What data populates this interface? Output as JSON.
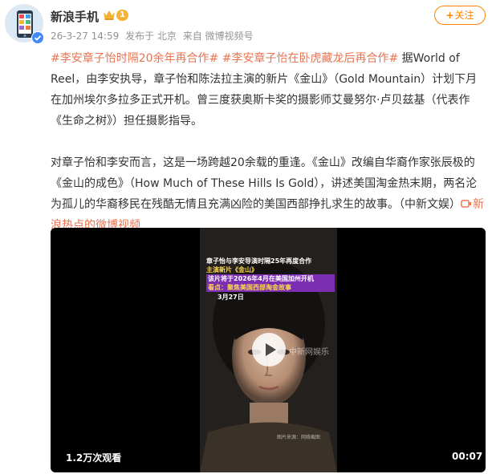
{
  "post": {
    "author": {
      "name": "新浪手机",
      "level": "1",
      "avatar_icon": "phone-app-icon",
      "verified_icon": "verified-badge-icon"
    },
    "meta": {
      "time": "26-3-27 14:59",
      "location": "发布于 北京",
      "source": "来自 微博视频号"
    },
    "follow_label": "关注",
    "paragraph_1": {
      "topic_1": "#李安章子怡时隔20余年再合作#",
      "topic_2": "#李安章子怡在卧虎藏龙后再合作#",
      "text": "据World of Reel，由李安执导，章子怡和陈法拉主演的新片《金山》（Gold Mountain）计划下月在加州埃尔多拉多正式开机。曾三度获奥斯卡奖的摄影师艾曼努尔·卢贝兹基（代表作《生命之树》）担任摄影指导。"
    },
    "paragraph_2": {
      "text": "对章子怡和李安而言，这是一场跨越20余载的重逢。《金山》改编自华裔作家张辰极的《金山的成色》（How Much of These Hills Is Gold），讲述美国淘金热末期，两名沦为孤儿的华裔移民在残酷无情且充满凶险的美国西部挣扎求生的故事。（中新文娱）",
      "link_text": "新浪热点的微博视频"
    },
    "video": {
      "views": "1.2万次观看",
      "duration": "00:07",
      "caption_lines": [
        "章子怡与李安导演时隔25年再度合作",
        "主演新片《金山》",
        "该片将于2026年4月在美国加州开机",
        "看点：聚焦美国西部淘金故事"
      ],
      "date_tag": "3月27日",
      "watermark": "中新网娱乐",
      "credit": "图片来源：网络截图",
      "play_icon": "play-icon"
    },
    "colors": {
      "accent": "#ff8200",
      "topic": "#eb7350",
      "meta": "#939393"
    }
  }
}
